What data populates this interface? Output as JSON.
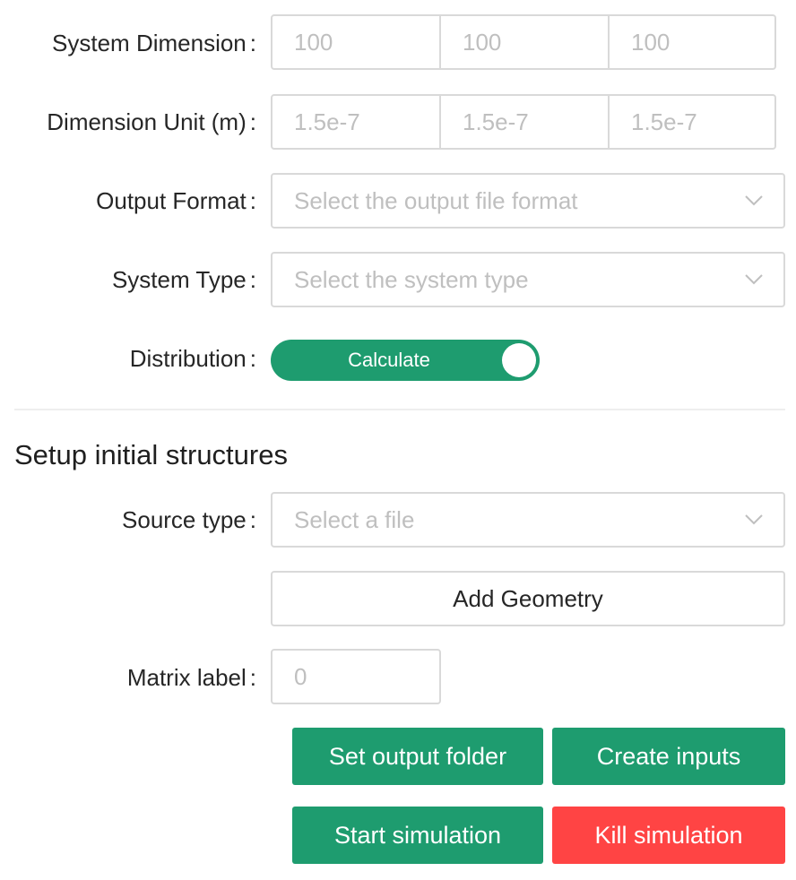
{
  "form": {
    "system_dimension": {
      "label": "System Dimension",
      "placeholders": [
        "100",
        "100",
        "100"
      ]
    },
    "dimension_unit": {
      "label": "Dimension Unit (m)",
      "placeholders": [
        "1.5e-7",
        "1.5e-7",
        "1.5e-7"
      ]
    },
    "output_format": {
      "label": "Output Format",
      "placeholder": "Select the output file format"
    },
    "system_type": {
      "label": "System Type",
      "placeholder": "Select the system type"
    },
    "distribution": {
      "label": "Distribution",
      "switch_text": "Calculate",
      "on": true
    },
    "colon": ":"
  },
  "structures": {
    "title": "Setup initial structures",
    "source_type": {
      "label": "Source type",
      "placeholder": "Select a file"
    },
    "add_geometry_label": "Add Geometry",
    "matrix_label": {
      "label": "Matrix label",
      "placeholder": "0"
    }
  },
  "actions": {
    "set_output_folder": "Set output folder",
    "create_inputs": "Create inputs",
    "start_simulation": "Start simulation",
    "kill_simulation": "Kill simulation"
  },
  "colors": {
    "primary": "#1e9c6f",
    "danger": "#ff4444",
    "border": "#d9d9d9",
    "placeholder": "#bfbfbf"
  },
  "icons": {
    "select_arrow": "chevron-down-icon"
  }
}
